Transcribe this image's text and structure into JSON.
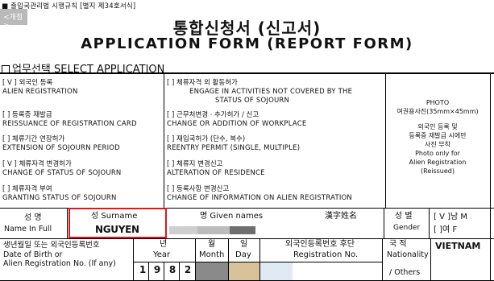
{
  "header": {
    "regulation": "■ 출입국관리법 시행규칙 [별지 제34호서식]",
    "stamp": "<개정>",
    "title_ko": "통합신청서 (신고서)",
    "title_en": "APPLICATION FORM (REPORT FORM)"
  },
  "select_application": {
    "heading": "업무선택 SELECT APPLICATION",
    "options": [
      {
        "mark": "[ V ]",
        "ko": "외국인 등록",
        "en": "ALIEN REGISTRATION"
      },
      {
        "mark": "[  ]",
        "ko": "체류자격 외 활동허가",
        "en": "ENGAGE IN ACTIVITIES NOT COVERED BY THE",
        "en2": "STATUS OF SOJOURN"
      },
      {
        "mark": "[  ]",
        "ko": "등록증 재발급",
        "en": "REISSUANCE OF REGISTRATION CARD"
      },
      {
        "mark": "[  ]",
        "ko": "근무처변경ㆍ추가허가 / 신고",
        "en": "CHANGE OR ADDITION OF WORKPLACE"
      },
      {
        "mark": "[  ]",
        "ko": "체류기간 연장허가",
        "en": "EXTENSION OF SOJOURN PERIOD"
      },
      {
        "mark": "[  ]",
        "ko": "재입국허가 (단수, 복수)",
        "en": "REENTRY PERMIT (SINGLE, MULTIPLE)"
      },
      {
        "mark": "[ V ]",
        "ko": "체류자격 변경허가",
        "en": "CHANGE OF STATUS OF SOJOURN"
      },
      {
        "mark": "[  ]",
        "ko": "체류지 변경신고",
        "en": "ALTERATION OF RESIDENCE"
      },
      {
        "mark": "[  ]",
        "ko": "체류자격 부여",
        "en": "GRANTING STATUS OF SOJOURN"
      },
      {
        "mark": "[  ]",
        "ko": "등록사항 변경신고",
        "en": "CHANGE OF INFORMATION ON ALIEN REGISTRATION"
      }
    ],
    "photo": {
      "line1": "PHOTO",
      "line2": "여권용사진(35mm×45mm)",
      "line3": "외국인 등록 및",
      "line4": "등록증 재발급 시에만",
      "line5": "사진 부착",
      "line6": "Photo only for",
      "line7": "Alien Registration",
      "line8": "(Reissued)"
    }
  },
  "name_row": {
    "label_ko": "성 명",
    "label_en": "Name In Full",
    "surname_label": "성 Surname",
    "surname_value": "NGUYEN",
    "given_label": "명 Given names",
    "hanja_label": "漢字姓名",
    "gender_ko": "성 별",
    "gender_en": "Gender",
    "male": "[ V ]남 M",
    "female": "[  ]여 F"
  },
  "dob_row": {
    "label_ko": "생년월일 또는 외국인등록번호",
    "label_en1": "Date of Birth or",
    "label_en2": "Alien Registration No. (If any)",
    "year_ko": "년",
    "year_en": "Year",
    "month_ko": "월",
    "month_en": "Month",
    "day_ko": "일",
    "day_en": "Day",
    "regno_ko": "외국인등록번호 후단",
    "regno_en": "Registration No.",
    "year_digits": [
      "1",
      "9",
      "8",
      "2"
    ],
    "nation_ko": "국 적",
    "nation_en1": "Nationality",
    "nation_en2": "/ Others",
    "nation_value": "VIETNAM"
  }
}
